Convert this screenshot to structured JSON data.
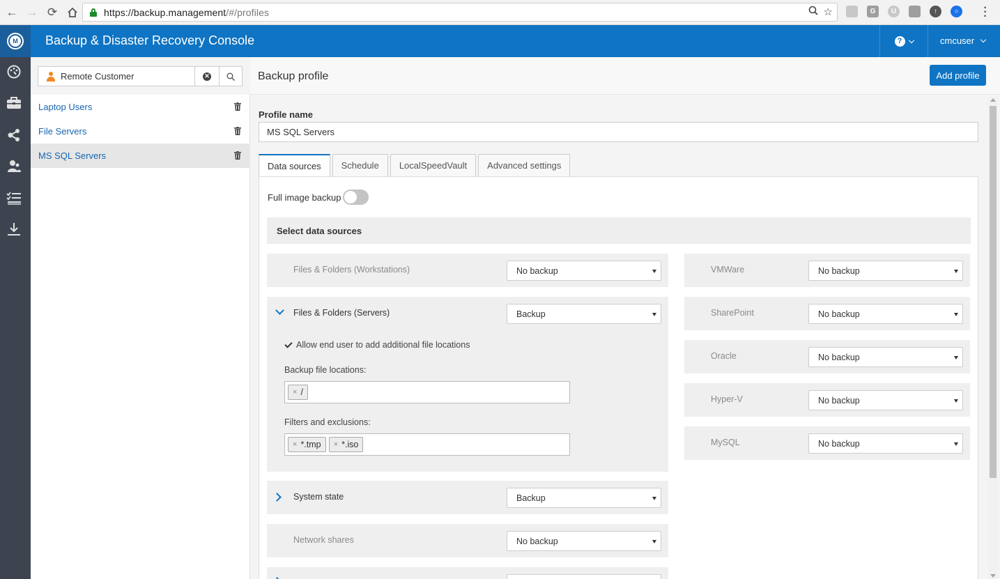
{
  "browser": {
    "url_host": "https://backup.management",
    "url_path": "/#/profiles"
  },
  "header": {
    "title": "Backup & Disaster Recovery Console",
    "logo_letter": "M",
    "help_symbol": "?",
    "user": "cmcuser"
  },
  "rail": {
    "icons": [
      "dashboard-icon",
      "briefcase-icon",
      "share-icon",
      "users-icon",
      "checklist-icon",
      "download-icon"
    ]
  },
  "customer_search": {
    "value": "Remote Customer"
  },
  "profiles": [
    {
      "label": "Laptop Users",
      "active": false
    },
    {
      "label": "File Servers",
      "active": false
    },
    {
      "label": "MS SQL Servers",
      "active": true
    }
  ],
  "main": {
    "page_title": "Backup profile",
    "add_button": "Add profile",
    "profile_name_label": "Profile name",
    "profile_name_value": "MS SQL Servers"
  },
  "tabs": [
    {
      "label": "Data sources",
      "active": true
    },
    {
      "label": "Schedule",
      "active": false
    },
    {
      "label": "LocalSpeedVault",
      "active": false
    },
    {
      "label": "Advanced settings",
      "active": false
    }
  ],
  "data_sources": {
    "full_image_label": "Full image backup",
    "full_image_enabled": false,
    "section_title": "Select data sources",
    "left": [
      {
        "name": "Files & Folders (Workstations)",
        "value": "No backup"
      },
      {
        "name": "Files & Folders (Servers)",
        "value": "Backup"
      },
      {
        "name": "System state",
        "value": "Backup"
      },
      {
        "name": "Network shares",
        "value": "No backup"
      }
    ],
    "right": [
      {
        "name": "VMWare",
        "value": "No backup"
      },
      {
        "name": "SharePoint",
        "value": "No backup"
      },
      {
        "name": "Oracle",
        "value": "No backup"
      },
      {
        "name": "Hyper-V",
        "value": "No backup"
      },
      {
        "name": "MySQL",
        "value": "No backup"
      }
    ],
    "servers_detail": {
      "allow_label": "Allow end user to add additional file locations",
      "allow_checked": true,
      "locations_label": "Backup file locations:",
      "locations": [
        "/"
      ],
      "filters_label": "Filters and exclusions:",
      "filters": [
        "*.tmp",
        "*.iso"
      ]
    }
  },
  "colors": {
    "brand_blue": "#0f74c3",
    "rail_bg": "#3d4450",
    "link_blue": "#1666b0"
  }
}
